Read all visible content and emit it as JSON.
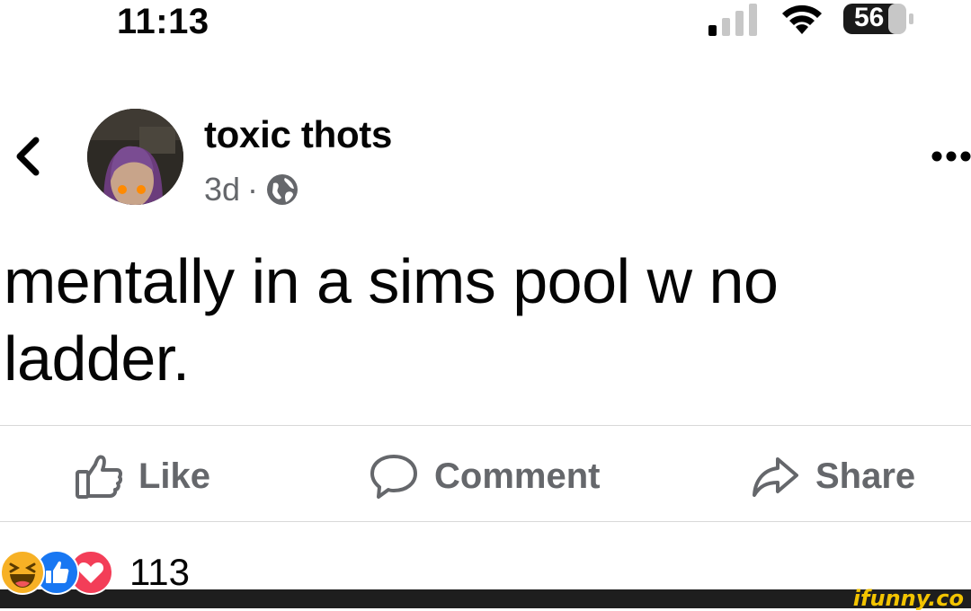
{
  "status_bar": {
    "time": "11:13",
    "battery_level": "56"
  },
  "header": {
    "author_name": "toxic thots",
    "time_ago": "3d",
    "separator": "·",
    "audience_icon": "globe-icon"
  },
  "post": {
    "text": "mentally in a sims pool w no ladder."
  },
  "actions": {
    "like_label": "Like",
    "comment_label": "Comment",
    "share_label": "Share"
  },
  "reactions": {
    "types": [
      "haha",
      "like",
      "love"
    ],
    "count": "113"
  },
  "watermark": {
    "text": "ifunny.co"
  },
  "colors": {
    "text": "#050505",
    "secondary": "#65676b",
    "like_blue": "#1877f2",
    "love_red": "#f33e58",
    "haha_yellow": "#f7b125"
  }
}
